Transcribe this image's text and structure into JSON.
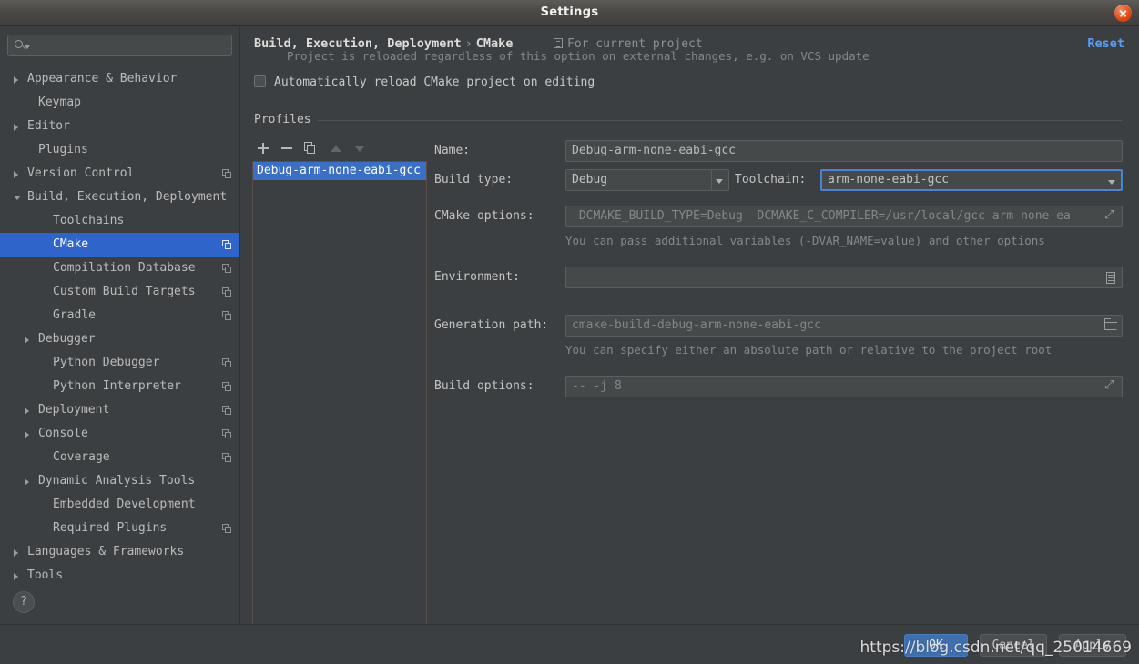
{
  "window": {
    "title": "Settings",
    "close_icon": "close-icon"
  },
  "sidebar": {
    "search": {
      "value": "",
      "placeholder": ""
    },
    "items": [
      {
        "label": "Appearance & Behavior",
        "indent": 0,
        "arrow": "right",
        "copy": false,
        "selected": false
      },
      {
        "label": "Keymap",
        "indent": 1,
        "arrow": "none",
        "copy": false,
        "selected": false
      },
      {
        "label": "Editor",
        "indent": 0,
        "arrow": "right",
        "copy": false,
        "selected": false
      },
      {
        "label": "Plugins",
        "indent": 1,
        "arrow": "none",
        "copy": false,
        "selected": false
      },
      {
        "label": "Version Control",
        "indent": 0,
        "arrow": "right",
        "copy": true,
        "selected": false
      },
      {
        "label": "Build, Execution, Deployment",
        "indent": 0,
        "arrow": "down",
        "copy": false,
        "selected": false
      },
      {
        "label": "Toolchains",
        "indent": 2,
        "arrow": "none",
        "copy": false,
        "selected": false
      },
      {
        "label": "CMake",
        "indent": 2,
        "arrow": "none",
        "copy": true,
        "selected": true
      },
      {
        "label": "Compilation Database",
        "indent": 2,
        "arrow": "none",
        "copy": true,
        "selected": false
      },
      {
        "label": "Custom Build Targets",
        "indent": 2,
        "arrow": "none",
        "copy": true,
        "selected": false
      },
      {
        "label": "Gradle",
        "indent": 2,
        "arrow": "none",
        "copy": true,
        "selected": false
      },
      {
        "label": "Debugger",
        "indent": 1,
        "arrow": "right",
        "copy": false,
        "selected": false
      },
      {
        "label": "Python Debugger",
        "indent": 2,
        "arrow": "none",
        "copy": true,
        "selected": false
      },
      {
        "label": "Python Interpreter",
        "indent": 2,
        "arrow": "none",
        "copy": true,
        "selected": false
      },
      {
        "label": "Deployment",
        "indent": 1,
        "arrow": "right",
        "copy": true,
        "selected": false
      },
      {
        "label": "Console",
        "indent": 1,
        "arrow": "right",
        "copy": true,
        "selected": false
      },
      {
        "label": "Coverage",
        "indent": 2,
        "arrow": "none",
        "copy": true,
        "selected": false
      },
      {
        "label": "Dynamic Analysis Tools",
        "indent": 1,
        "arrow": "right",
        "copy": false,
        "selected": false
      },
      {
        "label": "Embedded Development",
        "indent": 2,
        "arrow": "none",
        "copy": false,
        "selected": false
      },
      {
        "label": "Required Plugins",
        "indent": 2,
        "arrow": "none",
        "copy": true,
        "selected": false
      },
      {
        "label": "Languages & Frameworks",
        "indent": 0,
        "arrow": "right",
        "copy": false,
        "selected": false
      },
      {
        "label": "Tools",
        "indent": 0,
        "arrow": "right",
        "copy": false,
        "selected": false
      }
    ],
    "help_label": "?"
  },
  "header": {
    "breadcrumb_parent": "Build, Execution, Deployment",
    "breadcrumb_sep": "›",
    "breadcrumb_current": "CMake",
    "scope_label": "For current project",
    "reset_label": "Reset"
  },
  "options": {
    "auto_reload_label": "Automatically reload CMake project on editing",
    "auto_reload_checked": false,
    "auto_reload_hint": "Project is reloaded regardless of this option on external changes, e.g. on VCS update"
  },
  "profiles": {
    "legend": "Profiles",
    "toolbar": {
      "add": "+",
      "remove": "−",
      "copy_icon": "duplicate-icon",
      "move_up_icon": "arrow-up-icon",
      "move_down_icon": "arrow-down-icon"
    },
    "items": [
      {
        "label": "Debug-arm-none-eabi-gcc",
        "selected": true
      }
    ]
  },
  "form": {
    "name": {
      "label": "Name:",
      "value": "Debug-arm-none-eabi-gcc"
    },
    "build_type": {
      "label": "Build type:",
      "value": "Debug"
    },
    "toolchain": {
      "label": "Toolchain:",
      "value": "arm-none-eabi-gcc",
      "focused": true
    },
    "cmake_options": {
      "label": "CMake options:",
      "value": "-DCMAKE_BUILD_TYPE=Debug -DCMAKE_C_COMPILER=/usr/local/gcc-arm-none-ea",
      "hint": "You can pass additional variables (-DVAR_NAME=value) and other options",
      "expand_icon": "expand-icon"
    },
    "environment": {
      "label": "Environment:",
      "value": "",
      "edit_icon": "environment-variables-icon"
    },
    "generation_path": {
      "label": "Generation path:",
      "value": "cmake-build-debug-arm-none-eabi-gcc",
      "hint": "You can specify either an absolute path or relative to the project root",
      "browse_icon": "folder-icon"
    },
    "build_options": {
      "label": "Build options:",
      "value": "-- -j 8",
      "expand_icon": "expand-icon"
    }
  },
  "footer": {
    "ok_label": "OK",
    "cancel_label": "Cancel",
    "apply_label": "Apply",
    "watermark": "https://blog.csdn.net/qq_25014669"
  },
  "colors": {
    "accent_blue": "#3a6fc4",
    "link_blue": "#589df6",
    "selection_blue": "#2f65ca",
    "close_orange": "#dd4814",
    "panel_bg": "#3c3f41",
    "field_bg": "#45494a"
  }
}
